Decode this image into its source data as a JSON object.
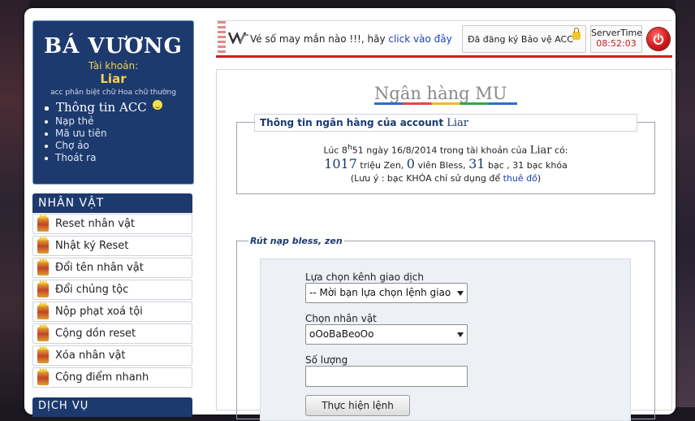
{
  "account_box": {
    "brand": "BÁ VƯƠNG",
    "caption": "Tài khoản:",
    "username": "Liar",
    "note": "acc phân biệt chữ Hoa chữ thường",
    "menu": [
      "Thông tin ACC",
      "Nạp thẻ",
      "Mã ưu tiên",
      "Chợ ảo",
      "Thoát ra"
    ]
  },
  "character_menu": {
    "title": "NHÂN VẬT",
    "items": [
      "Reset nhân vật",
      "Nhật ký Reset",
      "Đổi tên nhân vật",
      "Đổi chủng tộc",
      "Nộp phạt xoá tội",
      "Cộng dồn reset",
      "Xóa nhân vật",
      "Cộng điểm nhanh"
    ],
    "next_title": "DỊCH VỤ"
  },
  "topbar": {
    "lottery_text": "Vé số may mắn nào !!!, hãy",
    "lottery_link": "click vào đây",
    "register_text": "Đã đăng ký Bảo vệ ACC",
    "server_label": "ServerTime",
    "server_time": "08:52:03"
  },
  "main": {
    "page_title": "Ngân hàng MU",
    "bank_info": {
      "legend_prefix": "Thông tin ngân hàng của account",
      "legend_account": "Liar",
      "line1_a": "Lúc 8",
      "line1_sup": "h",
      "line1_b": "51 ngày 16/8/2014 trong tài khoản của",
      "line1_account": "Liar",
      "line1_c": "có:",
      "zen_value": "1017",
      "zen_unit": "triệu Zen,",
      "bless_value": "0",
      "bless_unit": "viên Bless,",
      "silver_value": "31",
      "silver_unit": "bạc ,",
      "locked_silver": "31 bạc khóa",
      "note_prefix": "(Lưu ý : bạc KHÓA chỉ sử dụng để",
      "note_link": "thuê đồ",
      "note_suffix": ")"
    },
    "withdraw": {
      "legend": "Rút nạp bless, zen",
      "channel_label": "Lựa chọn kênh giao dịch",
      "channel_value": "-- Mời bạn lựa chọn lệnh giao",
      "character_label": "Chọn nhân vật",
      "character_value": "oOoBaBeoOo",
      "amount_label": "Số lượng",
      "amount_value": "",
      "submit_label": "Thực hiện lệnh"
    }
  },
  "colors": {
    "navy": "#1d3a6e",
    "gold": "#f2d24b",
    "link_blue": "#1a3fb8",
    "alert_red": "#c62020"
  }
}
